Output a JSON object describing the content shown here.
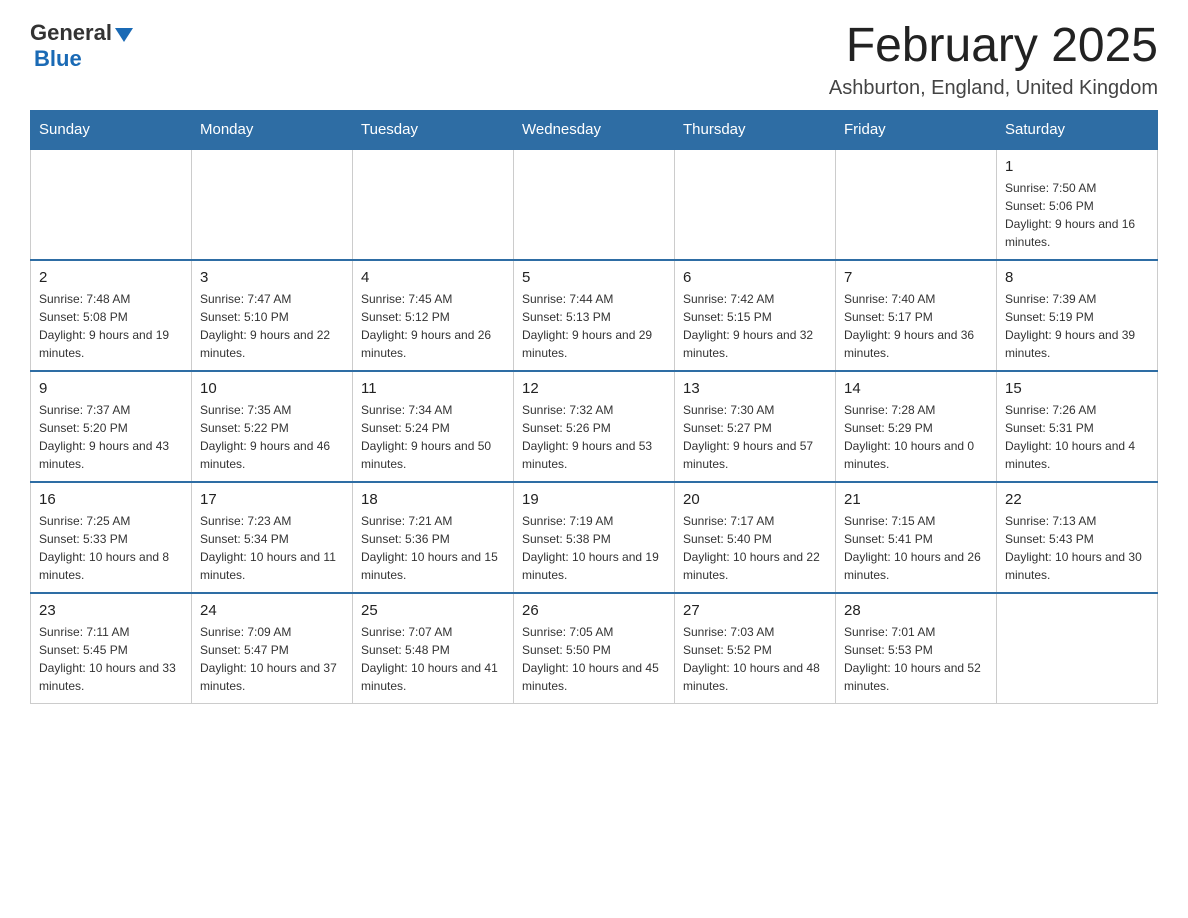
{
  "header": {
    "logo": {
      "general": "General",
      "blue": "Blue"
    },
    "title": "February 2025",
    "location": "Ashburton, England, United Kingdom"
  },
  "calendar": {
    "days_of_week": [
      "Sunday",
      "Monday",
      "Tuesday",
      "Wednesday",
      "Thursday",
      "Friday",
      "Saturday"
    ],
    "weeks": [
      [
        {
          "day": "",
          "info": ""
        },
        {
          "day": "",
          "info": ""
        },
        {
          "day": "",
          "info": ""
        },
        {
          "day": "",
          "info": ""
        },
        {
          "day": "",
          "info": ""
        },
        {
          "day": "",
          "info": ""
        },
        {
          "day": "1",
          "info": "Sunrise: 7:50 AM\nSunset: 5:06 PM\nDaylight: 9 hours and 16 minutes."
        }
      ],
      [
        {
          "day": "2",
          "info": "Sunrise: 7:48 AM\nSunset: 5:08 PM\nDaylight: 9 hours and 19 minutes."
        },
        {
          "day": "3",
          "info": "Sunrise: 7:47 AM\nSunset: 5:10 PM\nDaylight: 9 hours and 22 minutes."
        },
        {
          "day": "4",
          "info": "Sunrise: 7:45 AM\nSunset: 5:12 PM\nDaylight: 9 hours and 26 minutes."
        },
        {
          "day": "5",
          "info": "Sunrise: 7:44 AM\nSunset: 5:13 PM\nDaylight: 9 hours and 29 minutes."
        },
        {
          "day": "6",
          "info": "Sunrise: 7:42 AM\nSunset: 5:15 PM\nDaylight: 9 hours and 32 minutes."
        },
        {
          "day": "7",
          "info": "Sunrise: 7:40 AM\nSunset: 5:17 PM\nDaylight: 9 hours and 36 minutes."
        },
        {
          "day": "8",
          "info": "Sunrise: 7:39 AM\nSunset: 5:19 PM\nDaylight: 9 hours and 39 minutes."
        }
      ],
      [
        {
          "day": "9",
          "info": "Sunrise: 7:37 AM\nSunset: 5:20 PM\nDaylight: 9 hours and 43 minutes."
        },
        {
          "day": "10",
          "info": "Sunrise: 7:35 AM\nSunset: 5:22 PM\nDaylight: 9 hours and 46 minutes."
        },
        {
          "day": "11",
          "info": "Sunrise: 7:34 AM\nSunset: 5:24 PM\nDaylight: 9 hours and 50 minutes."
        },
        {
          "day": "12",
          "info": "Sunrise: 7:32 AM\nSunset: 5:26 PM\nDaylight: 9 hours and 53 minutes."
        },
        {
          "day": "13",
          "info": "Sunrise: 7:30 AM\nSunset: 5:27 PM\nDaylight: 9 hours and 57 minutes."
        },
        {
          "day": "14",
          "info": "Sunrise: 7:28 AM\nSunset: 5:29 PM\nDaylight: 10 hours and 0 minutes."
        },
        {
          "day": "15",
          "info": "Sunrise: 7:26 AM\nSunset: 5:31 PM\nDaylight: 10 hours and 4 minutes."
        }
      ],
      [
        {
          "day": "16",
          "info": "Sunrise: 7:25 AM\nSunset: 5:33 PM\nDaylight: 10 hours and 8 minutes."
        },
        {
          "day": "17",
          "info": "Sunrise: 7:23 AM\nSunset: 5:34 PM\nDaylight: 10 hours and 11 minutes."
        },
        {
          "day": "18",
          "info": "Sunrise: 7:21 AM\nSunset: 5:36 PM\nDaylight: 10 hours and 15 minutes."
        },
        {
          "day": "19",
          "info": "Sunrise: 7:19 AM\nSunset: 5:38 PM\nDaylight: 10 hours and 19 minutes."
        },
        {
          "day": "20",
          "info": "Sunrise: 7:17 AM\nSunset: 5:40 PM\nDaylight: 10 hours and 22 minutes."
        },
        {
          "day": "21",
          "info": "Sunrise: 7:15 AM\nSunset: 5:41 PM\nDaylight: 10 hours and 26 minutes."
        },
        {
          "day": "22",
          "info": "Sunrise: 7:13 AM\nSunset: 5:43 PM\nDaylight: 10 hours and 30 minutes."
        }
      ],
      [
        {
          "day": "23",
          "info": "Sunrise: 7:11 AM\nSunset: 5:45 PM\nDaylight: 10 hours and 33 minutes."
        },
        {
          "day": "24",
          "info": "Sunrise: 7:09 AM\nSunset: 5:47 PM\nDaylight: 10 hours and 37 minutes."
        },
        {
          "day": "25",
          "info": "Sunrise: 7:07 AM\nSunset: 5:48 PM\nDaylight: 10 hours and 41 minutes."
        },
        {
          "day": "26",
          "info": "Sunrise: 7:05 AM\nSunset: 5:50 PM\nDaylight: 10 hours and 45 minutes."
        },
        {
          "day": "27",
          "info": "Sunrise: 7:03 AM\nSunset: 5:52 PM\nDaylight: 10 hours and 48 minutes."
        },
        {
          "day": "28",
          "info": "Sunrise: 7:01 AM\nSunset: 5:53 PM\nDaylight: 10 hours and 52 minutes."
        },
        {
          "day": "",
          "info": ""
        }
      ]
    ]
  }
}
